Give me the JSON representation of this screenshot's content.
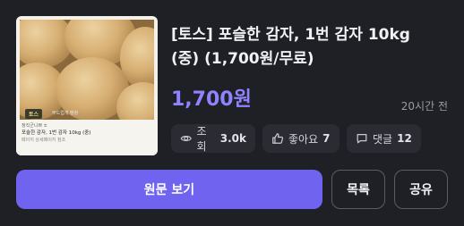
{
  "post": {
    "title": "[토스] 포슬한 감자, 1번 감자 10kg (중) (1,700원/무료)",
    "price": "1,700원",
    "time_ago": "20시간 전"
  },
  "thumbnail": {
    "badge": "토스",
    "badge_sub": "부드럽게 팽창",
    "caption_line1": "정직군니쁘 ±",
    "caption_line2": "포슬한 감자, 1번 감자 10kg (중)",
    "caption_line3": "페이지 상세페이지 참조"
  },
  "stats": {
    "views_label": "조회",
    "views_value": "3.0k",
    "likes_label": "좋아요",
    "likes_value": "7",
    "comments_label": "댓글",
    "comments_value": "12"
  },
  "actions": {
    "view_original": "원문 보기",
    "list": "목록",
    "share": "공유"
  },
  "colors": {
    "accent": "#6f63f0",
    "price": "#8f83ff",
    "background": "#1f2026"
  }
}
